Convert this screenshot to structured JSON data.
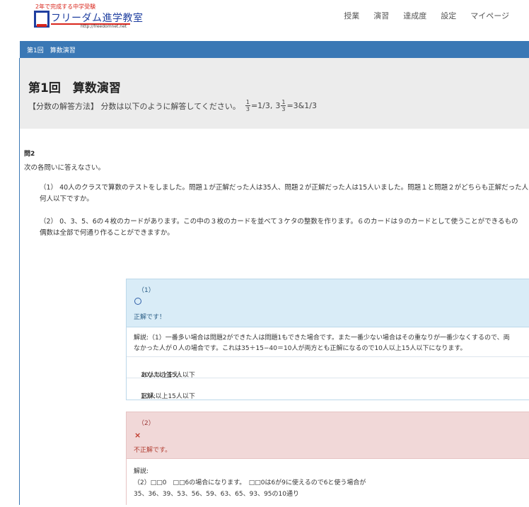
{
  "header": {
    "logo_tagline": "2年で完成する中学受験",
    "logo_name": "フリーダム進学教室",
    "logo_url": "http://freedomnet.net",
    "nav": [
      "授業",
      "演習",
      "達成度",
      "設定",
      "マイページ"
    ]
  },
  "band": {
    "title": "第1回　算数演習"
  },
  "hero": {
    "title": "第1回　算数演習",
    "note_prefix": "【分数の解答方法】 分数は以下のように解答してください。",
    "frac1_num": "1",
    "frac1_den": "3",
    "eq1": "=1/3,",
    "whole": "3",
    "frac2_num": "1",
    "frac2_den": "3",
    "eq2": "=3&1/3"
  },
  "question": {
    "heading": "問2",
    "intro": "次の各問いに答えなさい。",
    "q1_line1": "（1） 40人のクラスで算数のテストをしました。問題１が正解だった人は35人、問題２が正解だった人は15人いました。問題１と問題２がどちらも正解だった人",
    "q1_line2": "何人以下ですか。",
    "q2_line1": "（2） 0、3、5、6の４枚のカードがあります。この中の３枚のカードを並べて３ケタの整数を作ります。６のカードは９のカードとして使うことができるもの",
    "q2_line2": "偶数は全部で何通り作ることができますか。"
  },
  "answer1": {
    "label": "（1）",
    "mark": "○",
    "status": "正解です！",
    "expl_line1": "解説:（1）一番多い場合は問題2ができた人は問題1もできた場合です。また一番少ない場合はその重なりが一番少なくするので、両",
    "expl_line2": "なかった人が０人の場合です。これは35＋15−40＝10人が両方とも正解になるので10人以上15人以下になります。",
    "your_answer_label": "あなたの答え:",
    "your_answer": "10人以上15人以下",
    "correct_label": "正解:",
    "correct": "10人以上15人以下"
  },
  "answer2": {
    "label": "（2）",
    "mark": "×",
    "status": "不正解です。",
    "expl_label": "解説:",
    "expl_line1": "（2）□□0　□□6の場合になります。　□□0は6が9に使えるので6と使う場合が",
    "expl_line2": "35、36、39、53、56、59、63、65、93、95の10通り"
  }
}
